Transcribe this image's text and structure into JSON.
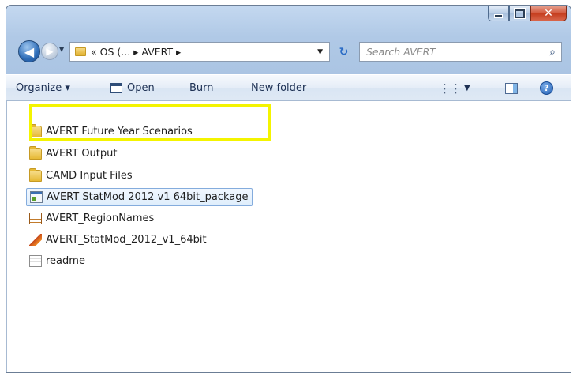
{
  "address": {
    "breadcrumb": "« OS (... ▸ AVERT ▸",
    "dropdown_glyph": "▼"
  },
  "search": {
    "placeholder": "Search AVERT"
  },
  "toolbar": {
    "organize_label": "Organize ▾",
    "open_label": "Open",
    "burn_label": "Burn",
    "new_folder_label": "New folder",
    "views_dropdown": "▼"
  },
  "files": [
    {
      "name": "AVERT Future Year Scenarios",
      "icon": "folder-icon",
      "selected": false
    },
    {
      "name": "AVERT Output",
      "icon": "folder-icon",
      "selected": false
    },
    {
      "name": "CAMD Input Files",
      "icon": "folder-icon",
      "selected": false
    },
    {
      "name": "AVERT StatMod 2012 v1 64bit_package",
      "icon": "application-icon",
      "selected": true
    },
    {
      "name": "AVERT_RegionNames",
      "icon": "spreadsheet-icon",
      "selected": false
    },
    {
      "name": "AVERT_StatMod_2012_v1_64bit",
      "icon": "matlab-icon",
      "selected": false
    },
    {
      "name": "readme",
      "icon": "text-file-icon",
      "selected": false
    }
  ],
  "colors": {
    "highlight": "#f4f400",
    "selection_border": "#84acdd",
    "close_button": "#c43b1c"
  }
}
